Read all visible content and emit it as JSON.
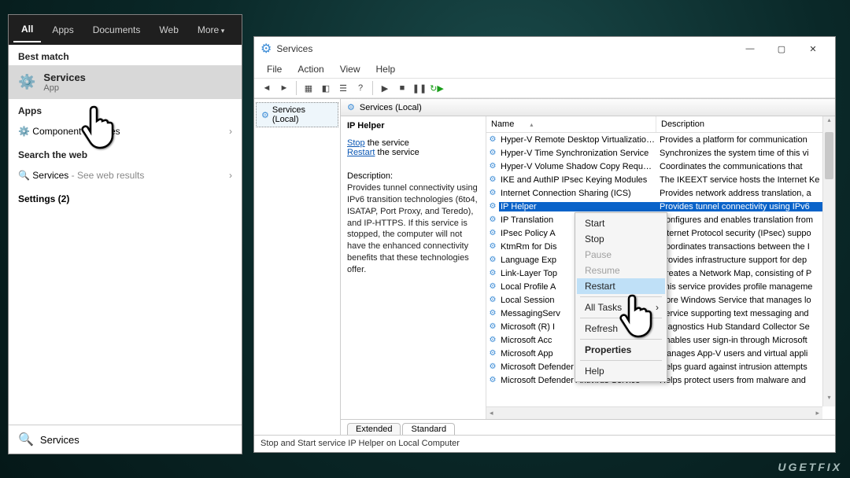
{
  "start": {
    "tabs": {
      "all": "All",
      "apps": "Apps",
      "documents": "Documents",
      "web": "Web",
      "more": "More"
    },
    "best_match_label": "Best match",
    "best_match": {
      "title": "Services",
      "sub": "App"
    },
    "apps_label": "Apps",
    "app_row": "Component Services",
    "search_web_label": "Search the web",
    "web_row_title": "Services",
    "web_row_sub": " - See web results",
    "settings_label": "Settings (2)",
    "search_value": "Services"
  },
  "services": {
    "title": "Services",
    "menu": {
      "file": "File",
      "action": "Action",
      "view": "View",
      "help": "Help"
    },
    "tree_root": "Services (Local)",
    "right_header": "Services (Local)",
    "detail": {
      "name": "IP Helper",
      "stop": "Stop",
      "stop_tail": " the service",
      "restart": "Restart",
      "restart_tail": " the service",
      "desc_label": "Description:",
      "desc": "Provides tunnel connectivity using IPv6 transition technologies (6to4, ISATAP, Port Proxy, and Teredo), and IP-HTTPS. If this service is stopped, the computer will not have the enhanced connectivity benefits that these technologies offer."
    },
    "columns": {
      "name": "Name",
      "desc": "Description"
    },
    "rows": [
      {
        "name": "Hyper-V Remote Desktop Virtualization...",
        "desc": "Provides a platform for communication"
      },
      {
        "name": "Hyper-V Time Synchronization Service",
        "desc": "Synchronizes the system time of this vi"
      },
      {
        "name": "Hyper-V Volume Shadow Copy Reques...",
        "desc": "Coordinates the communications that"
      },
      {
        "name": "IKE and AuthIP IPsec Keying Modules",
        "desc": "The IKEEXT service hosts the Internet Ke"
      },
      {
        "name": "Internet Connection Sharing (ICS)",
        "desc": "Provides network address translation, a"
      },
      {
        "name": "IP Helper",
        "desc": "Provides tunnel connectivity using IPv6",
        "selected": true
      },
      {
        "name": "IP Translation",
        "desc": "Configures and enables translation from"
      },
      {
        "name": "IPsec Policy A",
        "desc": "Internet Protocol security (IPsec) suppo"
      },
      {
        "name": "KtmRm for Dis",
        "desc": "Coordinates transactions between the I"
      },
      {
        "name": "Language Exp",
        "desc": "Provides infrastructure support for dep"
      },
      {
        "name": "Link-Layer Top",
        "desc": "Creates a Network Map, consisting of P"
      },
      {
        "name": "Local Profile A",
        "desc": "This service provides profile manageme"
      },
      {
        "name": "Local Session",
        "desc": "Core Windows Service that manages lo"
      },
      {
        "name": "MessagingServ",
        "desc": "Service supporting text messaging and"
      },
      {
        "name": "Microsoft (R) I",
        "desc": "Diagnostics Hub Standard Collector Se"
      },
      {
        "name": "Microsoft Acc",
        "desc": "Enables user sign-in through Microsoft"
      },
      {
        "name": "Microsoft App",
        "desc": "Manages App-V users and virtual appli"
      },
      {
        "name": "Microsoft Defender Antivirus Network I...",
        "desc": "Helps guard against intrusion attempts"
      },
      {
        "name": "Microsoft Defender Antivirus Service",
        "desc": "Helps protect users from malware and"
      }
    ],
    "tabs": {
      "extended": "Extended",
      "standard": "Standard"
    },
    "status": "Stop and Start service IP Helper on Local Computer"
  },
  "context_menu": {
    "start": "Start",
    "stop": "Stop",
    "pause": "Pause",
    "resume": "Resume",
    "restart": "Restart",
    "all_tasks": "All Tasks",
    "refresh": "Refresh",
    "properties": "Properties",
    "help": "Help"
  },
  "watermark": "UGETFIX"
}
